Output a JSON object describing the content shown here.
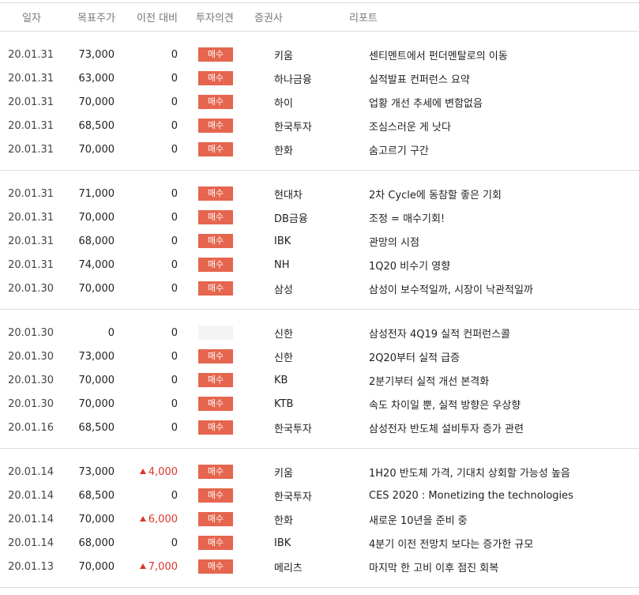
{
  "headers": {
    "date": "일자",
    "target": "목표주가",
    "change": "이전 대비",
    "opinion": "투자의견",
    "broker": "증권사",
    "report": "리포트"
  },
  "colors": {
    "badge_bg": "#e5654e",
    "up_red": "#d9382c",
    "divider": "#dddddd"
  },
  "groups": [
    {
      "rows": [
        {
          "date": "20.01.31",
          "target": "73,000",
          "change": "0",
          "up": false,
          "opinion": "매수",
          "broker": "키움",
          "report": "센티멘트에서 펀더멘탈로의 이동"
        },
        {
          "date": "20.01.31",
          "target": "63,000",
          "change": "0",
          "up": false,
          "opinion": "매수",
          "broker": "하나금융",
          "report": "실적발표 컨퍼런스 요약"
        },
        {
          "date": "20.01.31",
          "target": "70,000",
          "change": "0",
          "up": false,
          "opinion": "매수",
          "broker": "하이",
          "report": "업황 개선 추세에 변함없음"
        },
        {
          "date": "20.01.31",
          "target": "68,500",
          "change": "0",
          "up": false,
          "opinion": "매수",
          "broker": "한국투자",
          "report": "조심스러운 게 낫다"
        },
        {
          "date": "20.01.31",
          "target": "70,000",
          "change": "0",
          "up": false,
          "opinion": "매수",
          "broker": "한화",
          "report": "숨고르기 구간"
        }
      ]
    },
    {
      "rows": [
        {
          "date": "20.01.31",
          "target": "71,000",
          "change": "0",
          "up": false,
          "opinion": "매수",
          "broker": "현대차",
          "report": "2차 Cycle에 동참할 좋은 기회"
        },
        {
          "date": "20.01.31",
          "target": "70,000",
          "change": "0",
          "up": false,
          "opinion": "매수",
          "broker": "DB금융",
          "report": "조정 = 매수기회!"
        },
        {
          "date": "20.01.31",
          "target": "68,000",
          "change": "0",
          "up": false,
          "opinion": "매수",
          "broker": "IBK",
          "report": "관망의 시점"
        },
        {
          "date": "20.01.31",
          "target": "74,000",
          "change": "0",
          "up": false,
          "opinion": "매수",
          "broker": "NH",
          "report": "1Q20 비수기 영향"
        },
        {
          "date": "20.01.30",
          "target": "70,000",
          "change": "0",
          "up": false,
          "opinion": "매수",
          "broker": "삼성",
          "report": "삼성이 보수적일까, 시장이 낙관적일까"
        }
      ]
    },
    {
      "rows": [
        {
          "date": "20.01.30",
          "target": "0",
          "change": "0",
          "up": false,
          "opinion": "",
          "broker": "신한",
          "report": "삼성전자 4Q19 실적 컨퍼런스콜"
        },
        {
          "date": "20.01.30",
          "target": "73,000",
          "change": "0",
          "up": false,
          "opinion": "매수",
          "broker": "신한",
          "report": "2Q20부터 실적 급증"
        },
        {
          "date": "20.01.30",
          "target": "70,000",
          "change": "0",
          "up": false,
          "opinion": "매수",
          "broker": "KB",
          "report": "2분기부터 실적 개선 본격화"
        },
        {
          "date": "20.01.30",
          "target": "70,000",
          "change": "0",
          "up": false,
          "opinion": "매수",
          "broker": "KTB",
          "report": "속도 차이일 뿐, 실적 방향은 우상향"
        },
        {
          "date": "20.01.16",
          "target": "68,500",
          "change": "0",
          "up": false,
          "opinion": "매수",
          "broker": "한국투자",
          "report": "삼성전자 반도체 설비투자 증가 관련"
        }
      ]
    },
    {
      "rows": [
        {
          "date": "20.01.14",
          "target": "73,000",
          "change": "4,000",
          "up": true,
          "opinion": "매수",
          "broker": "키움",
          "report": "1H20 반도체 가격, 기대치 상회할 가능성 높음"
        },
        {
          "date": "20.01.14",
          "target": "68,500",
          "change": "0",
          "up": false,
          "opinion": "매수",
          "broker": "한국투자",
          "report": "CES 2020 : Monetizing the technologies"
        },
        {
          "date": "20.01.14",
          "target": "70,000",
          "change": "6,000",
          "up": true,
          "opinion": "매수",
          "broker": "한화",
          "report": "새로운 10년을 준비 중"
        },
        {
          "date": "20.01.14",
          "target": "68,000",
          "change": "0",
          "up": false,
          "opinion": "매수",
          "broker": "IBK",
          "report": "4분기 이전 전망치 보다는 증가한 규모"
        },
        {
          "date": "20.01.13",
          "target": "70,000",
          "change": "7,000",
          "up": true,
          "opinion": "매수",
          "broker": "메리츠",
          "report": "마지막 한 고비 이후 점진 회복"
        }
      ]
    }
  ]
}
